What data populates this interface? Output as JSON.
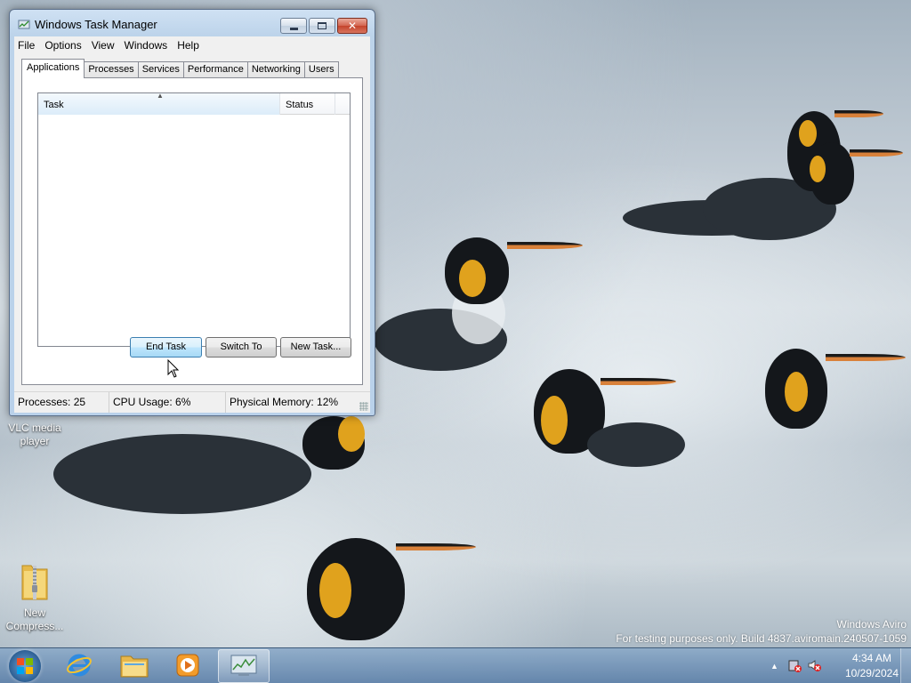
{
  "window": {
    "title": "Windows Task Manager",
    "menu": [
      "File",
      "Options",
      "View",
      "Windows",
      "Help"
    ],
    "tabs": [
      "Applications",
      "Processes",
      "Services",
      "Performance",
      "Networking",
      "Users"
    ],
    "active_tab": "Applications",
    "columns": [
      "Task",
      "Status"
    ],
    "buttons": {
      "end_task": "End Task",
      "switch_to": "Switch To",
      "new_task": "New Task..."
    },
    "status": {
      "processes": "Processes: 25",
      "cpu": "CPU Usage: 6%",
      "memory": "Physical Memory: 12%"
    }
  },
  "desktop_icons": [
    {
      "label": "VLC media player",
      "icon": "vlc-icon"
    },
    {
      "label": "New Compress...",
      "icon": "zip-folder-icon"
    }
  ],
  "watermark": {
    "line1": "Windows Aviro",
    "line2": "For testing purposes only. Build 4837.aviromain.240507-1059"
  },
  "taskbar": {
    "pinned": [
      "internet-explorer-icon",
      "file-explorer-icon",
      "media-player-icon",
      "task-manager-icon"
    ],
    "active": "task-manager-icon",
    "time": "4:34 AM",
    "date": "10/29/2024"
  },
  "colors": {
    "titlebar": "#bcd3ea",
    "close_button": "#c4432b",
    "taskbar": "#6f8fb3",
    "focus_button": "#bee6fd"
  }
}
